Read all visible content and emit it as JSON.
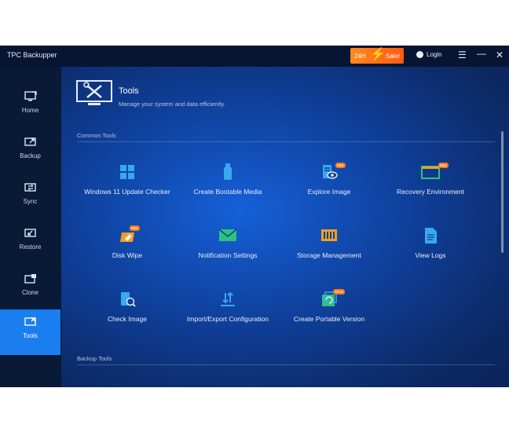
{
  "window": {
    "title": "TPC Backupper",
    "promo": {
      "label_24h": "24H",
      "label_sale": "Sale!"
    },
    "login_label": "Login"
  },
  "sidebar": {
    "items": [
      {
        "label": "Home",
        "icon": "home-icon"
      },
      {
        "label": "Backup",
        "icon": "backup-icon"
      },
      {
        "label": "Sync",
        "icon": "sync-icon"
      },
      {
        "label": "Restore",
        "icon": "restore-icon"
      },
      {
        "label": "Clone",
        "icon": "clone-icon"
      },
      {
        "label": "Tools",
        "icon": "tools-icon",
        "active": true
      }
    ]
  },
  "header": {
    "title": "Tools",
    "subtitle": "Manage your system and data efficiently."
  },
  "sections": {
    "common": "Common Tools",
    "backup": "Backup Tools"
  },
  "tools": [
    {
      "label": "Windows 11 Update Checker",
      "icon": "windows-icon"
    },
    {
      "label": "Create Bootable Media",
      "icon": "usb-drive-icon"
    },
    {
      "label": "Explore Image",
      "icon": "explore-image-icon",
      "badge": "PRO"
    },
    {
      "label": "Recovery Environment",
      "icon": "recovery-environment-icon",
      "badge": "PRO"
    },
    {
      "label": "Disk Wipe",
      "icon": "disk-wipe-icon",
      "badge": "PRO"
    },
    {
      "label": "Notification Settings",
      "icon": "mail-icon"
    },
    {
      "label": "Storage Management",
      "icon": "storage-icon"
    },
    {
      "label": "View Logs",
      "icon": "logs-icon"
    },
    {
      "label": "Check Image",
      "icon": "check-image-icon"
    },
    {
      "label": "Import/Export Configuration",
      "icon": "import-export-icon"
    },
    {
      "label": "Create Portable Version",
      "icon": "portable-icon",
      "badge": "TECH"
    }
  ],
  "colors": {
    "accent": "#1a7ef0",
    "sale": "#ff6a14",
    "icon_blue": "#38a8f0",
    "icon_green": "#2ec27e",
    "icon_orange": "#f0a020"
  }
}
